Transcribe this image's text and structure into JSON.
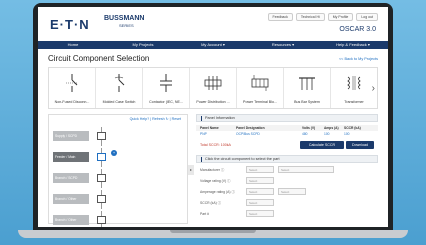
{
  "header": {
    "brand": "E·T·N",
    "product": "BUSSMANN",
    "product_sub": "SERIES",
    "app_version": "OSCAR 3.0",
    "top_links": [
      "Feedback",
      "Technical Hi",
      "My Profile",
      "Log out"
    ]
  },
  "nav": [
    "Home",
    "My Projects",
    "My Account ▾",
    "Resources ▾",
    "Help & Feedback ▾"
  ],
  "page": {
    "title": "Circuit Component Selection",
    "back_link": "<< Back to My Projects"
  },
  "components": [
    {
      "label": "Non-Fused Disconn...",
      "icon": "disconnect-icon"
    },
    {
      "label": "Molded Case Switch",
      "icon": "switch-icon"
    },
    {
      "label": "Contactor (IEC, NE...",
      "icon": "contactor-icon"
    },
    {
      "label": "Power Distribution ...",
      "icon": "fuse-block-icon"
    },
    {
      "label": "Power Terminal Blo...",
      "icon": "terminal-block-icon"
    },
    {
      "label": "Bus Bar System",
      "icon": "busbar-icon"
    },
    {
      "label": "Transformer",
      "icon": "transformer-icon"
    }
  ],
  "left_panel": {
    "links": "Quick Help? | Refresh ↻ | Reset",
    "rungs": [
      {
        "label": "Supply / SCPD",
        "dark": false
      },
      {
        "label": "Feeder / Main",
        "dark": true
      },
      {
        "label": "Branch / SCPD",
        "dark": false
      },
      {
        "label": "Branch / Other",
        "dark": false
      },
      {
        "label": "Branch / Other",
        "dark": false
      }
    ]
  },
  "panel_info": {
    "heading": "Panel Information",
    "columns": [
      "Panel Name",
      "Panel Designation",
      "Volts (V)",
      "Amps (A)",
      "SCCR (kA)"
    ],
    "row": [
      "PNP",
      "OCP/Bus SCPD",
      "480",
      "100",
      "100"
    ],
    "total_label": "Total SCCR: 100kA",
    "calc_button": "Calculate SCCR",
    "download_button": "Download"
  },
  "select_section": {
    "heading": "Click the circuit component to select the part",
    "fields": [
      {
        "label": "Manufacturer ⓘ",
        "value": "Select"
      },
      {
        "label": "Voltage rating (V) ⓘ",
        "value": "Select"
      },
      {
        "label": "Amperage rating (A) ⓘ",
        "value": "Select"
      },
      {
        "label": "SCCR (kA) ⓘ",
        "value": "Select"
      },
      {
        "label": "Part #",
        "value": "Select"
      }
    ]
  },
  "colors": {
    "brand_navy": "#1b3a6b",
    "link_blue": "#1f6fc1",
    "background": "#5aa9d6"
  }
}
